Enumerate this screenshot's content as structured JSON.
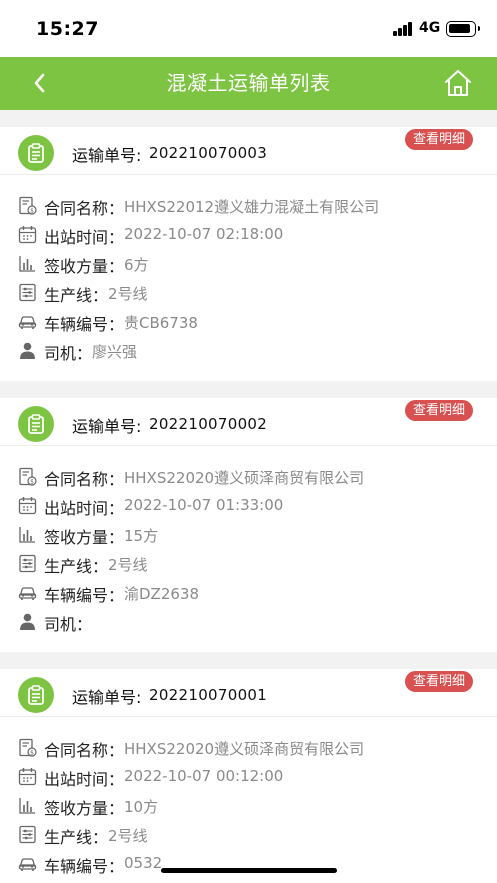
{
  "status_bar": {
    "time": "15:27",
    "network": "4G"
  },
  "nav": {
    "title": "混凝土运输单列表"
  },
  "labels": {
    "order_no": "运输单号:",
    "detail_button": "查看明细",
    "contract": "合同名称：",
    "depart_time": "出站时间：",
    "volume": "签收方量：",
    "line": "生产线：",
    "vehicle": "车辆编号：",
    "driver": "司机："
  },
  "orders": [
    {
      "order_no": "202210070003",
      "contract": "HHXS22012遵义雄力混凝土有限公司",
      "depart_time": "2022-10-07 02:18:00",
      "volume": "6方",
      "line": "2号线",
      "vehicle": "贵CB6738",
      "driver": "廖兴强"
    },
    {
      "order_no": "202210070002",
      "contract": "HHXS22020遵义硕泽商贸有限公司",
      "depart_time": "2022-10-07 01:33:00",
      "volume": "15方",
      "line": "2号线",
      "vehicle": "渝DZ2638",
      "driver": ""
    },
    {
      "order_no": "202210070001",
      "contract": "HHXS22020遵义硕泽商贸有限公司",
      "depart_time": "2022-10-07 00:12:00",
      "volume": "10方",
      "line": "2号线",
      "vehicle": "0532",
      "driver": ""
    }
  ],
  "colors": {
    "accent": "#7dc443",
    "detail_button": "#d95050"
  }
}
